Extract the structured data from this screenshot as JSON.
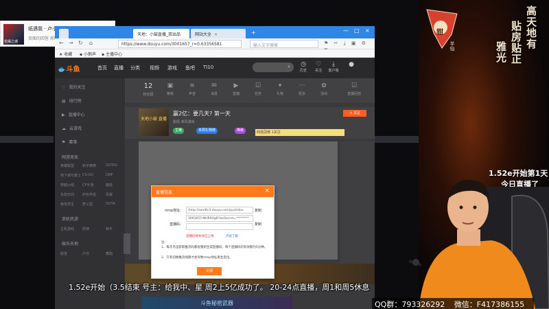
{
  "music": {
    "song": "纸遇我 - 卢小惠、童二",
    "artist": "双面的回答 郝晓达(SR)"
  },
  "music_cover_text": "花缘之城",
  "browser": {
    "tabs": [
      {
        "label": ""
      },
      {
        "label": "天地：小鼓直播_双出品"
      },
      {
        "label": "网站大全"
      }
    ],
    "url": "https://www.douyu.com/3001657_r=0.63356581",
    "search_placeholder": "输入文字搜索",
    "bookmarks": [
      "收藏",
      "小鹅声",
      "主播中心"
    ]
  },
  "douyu": {
    "logo": "斗鱼",
    "nav": [
      "首页",
      "直播",
      "分类",
      "视频",
      "游戏",
      "鱼吧",
      "TI10"
    ],
    "header_icons": [
      {
        "label": "历史",
        "icon": "history-icon"
      },
      {
        "label": "关注",
        "icon": "heart-icon"
      },
      {
        "label": "客户端",
        "icon": "download-icon"
      }
    ],
    "side_items": [
      "我的关注",
      "排行榜",
      "直播中心",
      "云游戏",
      "赛事"
    ],
    "side_sections": [
      "网游竞技",
      "单机热游",
      "娱乐天地"
    ],
    "side_subs": [
      [
        "英雄联盟",
        "和平精英",
        "DOTA2"
      ],
      [
        "地下城与勇士",
        "CS:GO",
        "DNF"
      ],
      [
        "穿越火线",
        "CF手游",
        "魔兽"
      ],
      [
        "永劫无间",
        "炉石传说",
        "风暴"
      ],
      [
        "绝地求生",
        "梦三国",
        "DOTA"
      ],
      [
        "主机游戏",
        "原神",
        "和平"
      ],
      [
        "颜值",
        "户外",
        "舞蹈"
      ]
    ],
    "categories": [
      {
        "top": "12",
        "label": "粉丝团"
      },
      {
        "top": "",
        "label": "等级"
      },
      {
        "top": "",
        "label": "声音"
      },
      {
        "top": "",
        "label": "消息"
      },
      {
        "top": "",
        "label": "直播"
      },
      {
        "top": "",
        "label": "任务"
      },
      {
        "top": "",
        "label": "礼物"
      },
      {
        "top": "",
        "label": "更多"
      },
      {
        "top": "",
        "label": "活动"
      },
      {
        "top": "",
        "label": "直播回放"
      }
    ],
    "room": {
      "avatar_text": "天地小鼓 直播",
      "title": "赢2亿：要几天?  第一天",
      "meta": "剧情   单机游戏",
      "follow": "+ 关注",
      "badges": [
        "主播",
        "本周礼物榜",
        "等级"
      ],
      "rank_strip": "四连冠榜 1关注"
    },
    "ad": "斗鱼秘密武器"
  },
  "dialog": {
    "title": "直播信息",
    "rtmp_label": "rtmp地址：",
    "rtmp_value": "rtmp://sendtc3.douyu.com/pushdou",
    "key_value": "3001657rNHRXXg6?wsSecret=********",
    "code_label": "直播码：",
    "copy": "复制",
    "red_text": "直播码将失效已上线",
    "link_text": "点此了解",
    "note_title": "注:",
    "note1": "1、每次点击获取推流码都会重新生成直播码，每个直播码的有效期为5分钟。",
    "note2": "2、只有切换推流线路才会导致rtmp地址发生变化。",
    "button": "关闭"
  },
  "decor": {
    "flag_char": "钳",
    "flag_sub": "半仙",
    "calligraphy1": "高天地有",
    "calligraphy2": "贴房贴正",
    "calligraphy3": "雅光",
    "announce_line1": "1.52e开始第1天",
    "announce_line2": "今日直播了",
    "arrows": "▼▼▼▼"
  },
  "ticker": "1.52e开始（3.5结束 号主：给我中、星 周2上5亿成功了。 20-24点直播，周1和周5休息",
  "qq": {
    "qq_group": "QQ群：793326292",
    "wechat": "微信：F417386155"
  }
}
